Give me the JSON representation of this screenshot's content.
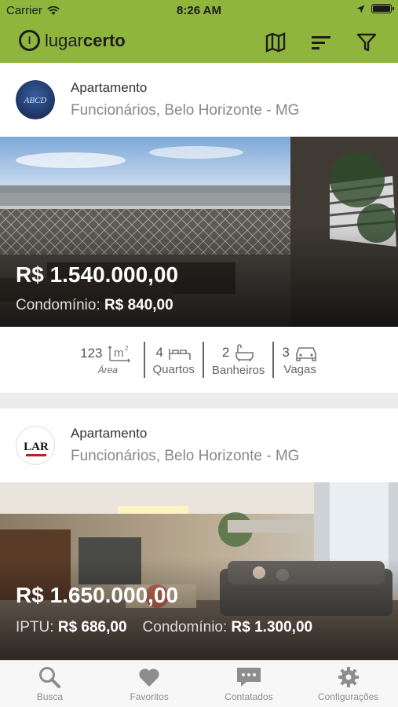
{
  "status": {
    "carrier": "Carrier",
    "time": "8:26 AM"
  },
  "brand": {
    "mark": "l",
    "name_regular": "lugar",
    "name_bold": "certo"
  },
  "actions": [
    "map-icon",
    "sort-icon",
    "filter-icon"
  ],
  "listings": [
    {
      "type": "Apartamento",
      "location": "Funcionários, Belo Horizonte - MG",
      "agency_logo_text": "ABCD",
      "price": "R$ 1.540.000,00",
      "fees": [
        {
          "label": "Condomínio:",
          "value": "R$ 840,00"
        }
      ],
      "features": [
        {
          "value": "123",
          "label": "Área",
          "icon": "area-icon"
        },
        {
          "value": "4",
          "label": "Quartos",
          "icon": "bed-icon"
        },
        {
          "value": "2",
          "label": "Banheiros",
          "icon": "bathtub-icon"
        },
        {
          "value": "3",
          "label": "Vagas",
          "icon": "car-icon"
        }
      ]
    },
    {
      "type": "Apartamento",
      "location": "Funcionários, Belo Horizonte - MG",
      "agency_logo_text": "LAR",
      "price": "R$ 1.650.000,00",
      "fees": [
        {
          "label": "IPTU:",
          "value": "R$ 686,00"
        },
        {
          "label": "Condomínio:",
          "value": "R$ 1.300,00"
        }
      ]
    }
  ],
  "tabs": [
    {
      "label": "Busca",
      "icon": "search-icon"
    },
    {
      "label": "Favoritos",
      "icon": "heart-icon"
    },
    {
      "label": "Contatados",
      "icon": "chat-icon"
    },
    {
      "label": "Configurações",
      "icon": "gear-icon"
    }
  ],
  "colors": {
    "brand_green": "#8fb53d",
    "tab_gray": "#8d8d8d"
  }
}
